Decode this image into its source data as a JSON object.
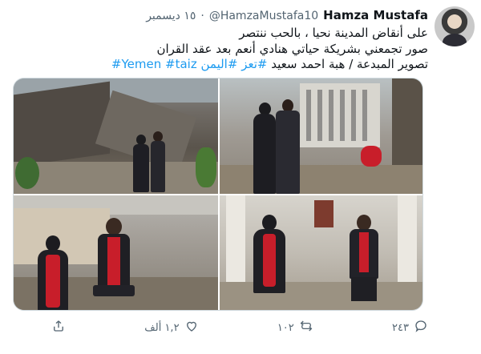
{
  "tweet": {
    "display_name": "Hamza Mustafa",
    "handle": "@HamzaMustafa10",
    "dot": "·",
    "date": "١٥ ديسمبر",
    "lines": [
      "على أنقاض المدينة نحيا ، بالحب ننتصر",
      "صور تجمعني بشريكة حياتي هنادي أنعم بعد عقد القران"
    ],
    "line3_prefix": "تصوير المبدعة / هبة احمد سعيد ",
    "hashtags": [
      "#تعز",
      "#اليمن",
      "#taiz",
      "#Yemen"
    ]
  },
  "actions": {
    "reply_count": "٢٤٣",
    "retweet_count": "١٠٢",
    "like_count": "١,٢ ألف"
  },
  "icons": {
    "reply": "reply-icon",
    "retweet": "retweet-icon",
    "like": "heart-icon",
    "share": "share-icon"
  },
  "colors": {
    "link": "#1d9bf0",
    "text": "#0f1419",
    "muted": "#536471",
    "dress_red": "#c81e2a"
  }
}
